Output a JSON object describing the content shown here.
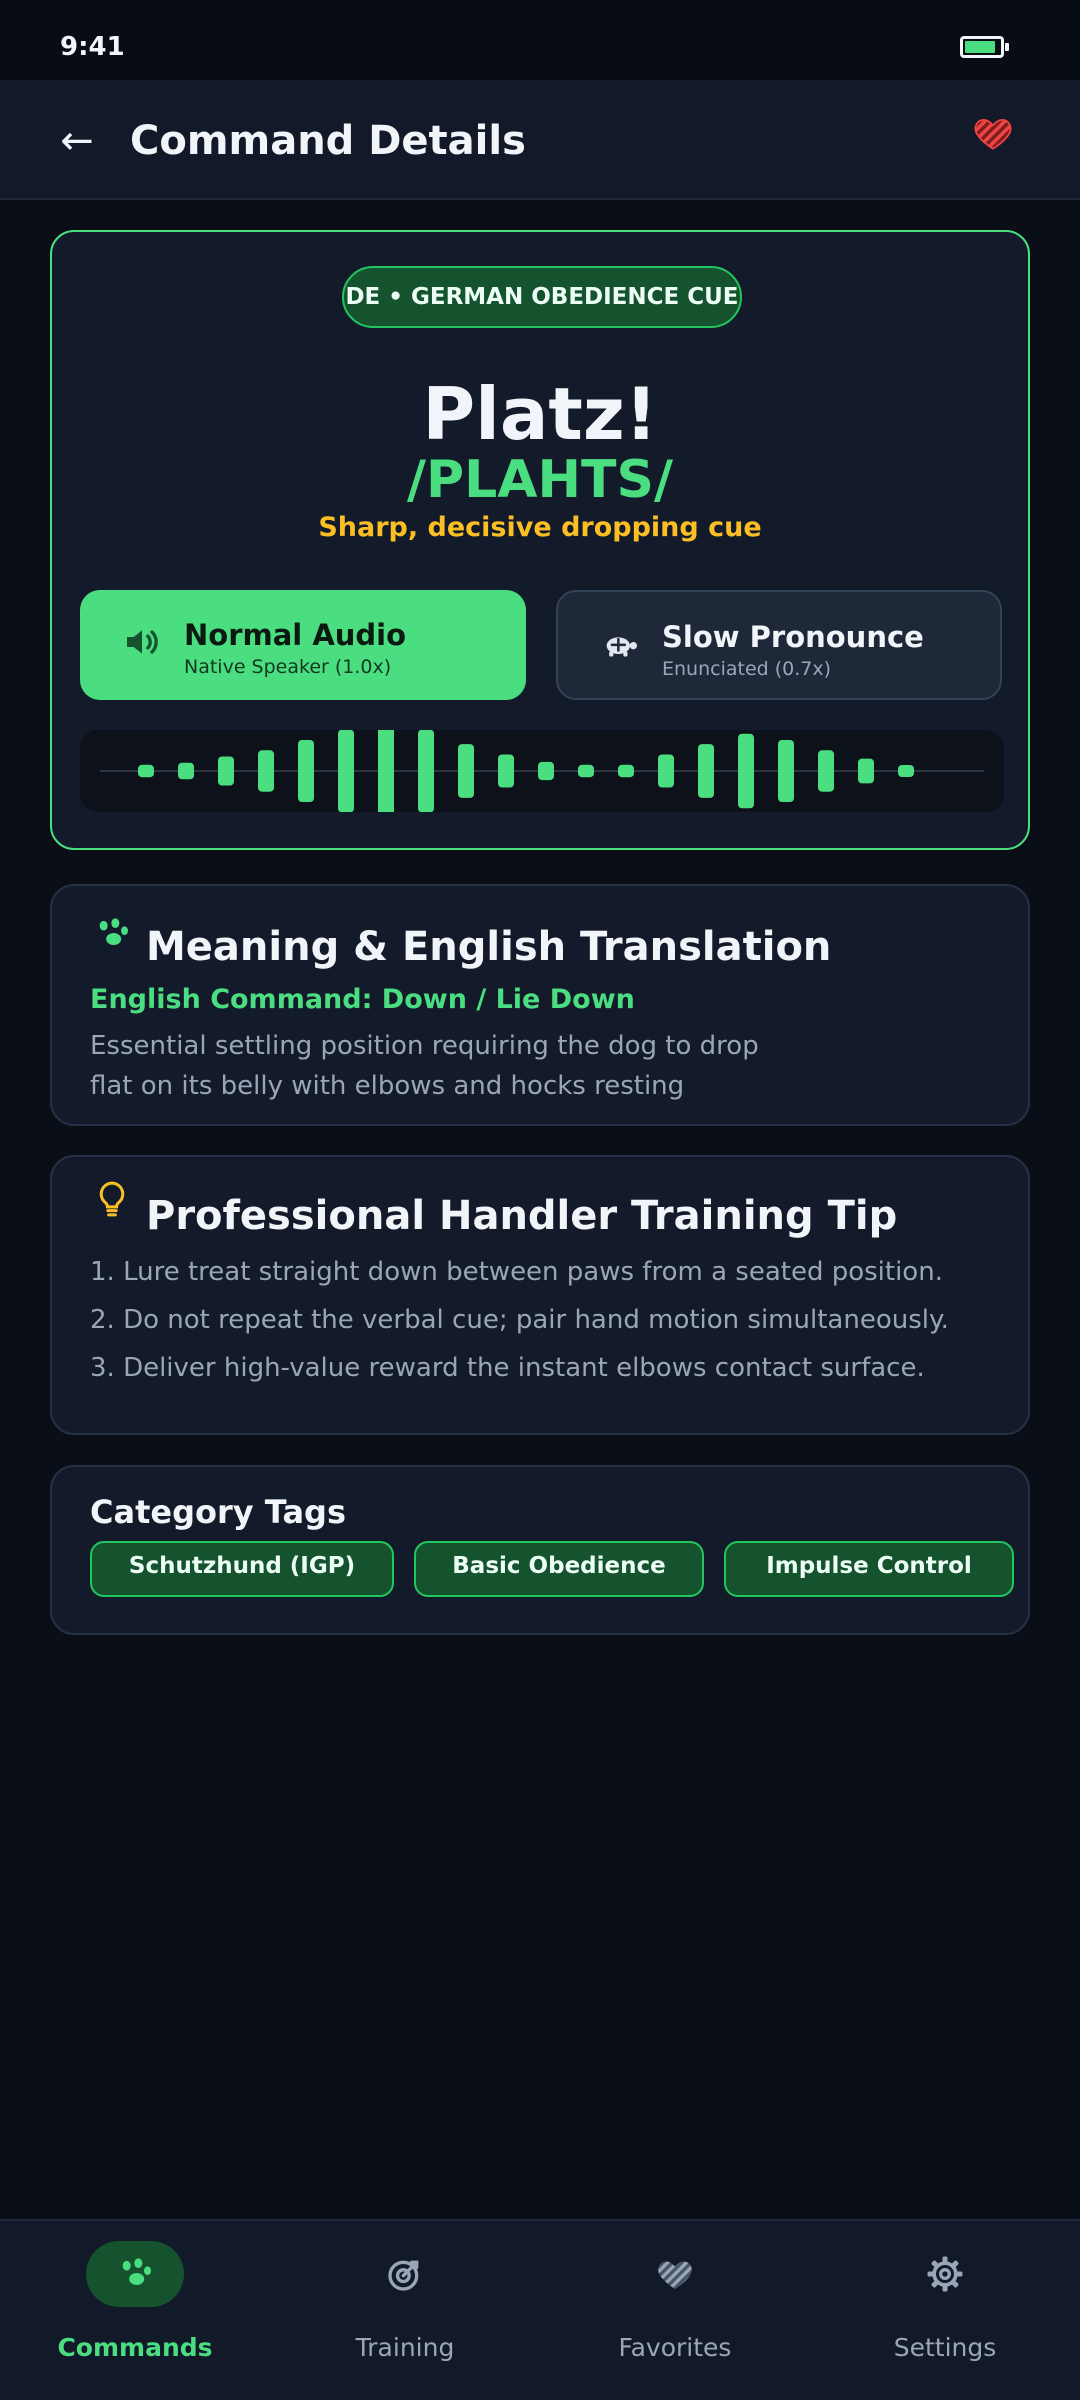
{
  "status_bar": {
    "time": "9:41",
    "battery_icon": "battery-icon"
  },
  "header": {
    "back_icon": "←",
    "title": "Command Details",
    "favorite_icon": "heart-icon"
  },
  "command": {
    "badge": "DE • GERMAN OBEDIENCE CUE",
    "word": "Platz!",
    "phonetic": "/PLAHTS/",
    "note": "Sharp, decisive dropping cue"
  },
  "audio": {
    "normal": {
      "title": "Normal Audio",
      "subtitle": "Native Speaker (1.0x)",
      "icon": "speaker-icon"
    },
    "slow": {
      "title": "Slow Pronounce",
      "subtitle": "Enunciated (0.7x)",
      "icon": "turtle-icon"
    },
    "waveform_levels": [
      0.15,
      0.2,
      0.35,
      0.5,
      0.75,
      1.0,
      1.2,
      1.0,
      0.65,
      0.4,
      0.22,
      0.15,
      0.15,
      0.4,
      0.65,
      0.9,
      0.75,
      0.5,
      0.3,
      0.12
    ]
  },
  "meaning": {
    "icon": "paw-icon",
    "title": "Meaning & English Translation",
    "english": "English Command: Down / Lie Down",
    "body": "Essential settling position requiring the dog to drop flat on its belly with elbows and hocks resting"
  },
  "tip": {
    "icon": "lightbulb-icon",
    "title": "Professional Handler Training Tip",
    "lines": [
      "1. Lure treat straight down between paws from a seated position.",
      "2. Do not repeat the verbal cue; pair hand motion simultaneously.",
      "3. Deliver high-value reward the instant elbows contact surface."
    ]
  },
  "tags": {
    "title": "Category Tags",
    "items": [
      "Schutzhund (IGP)",
      "Basic Obedience",
      "Impulse Control"
    ]
  },
  "nav": {
    "active": "Commands",
    "items": [
      {
        "label": "Commands",
        "icon": "paw-icon"
      },
      {
        "label": "Training",
        "icon": "target-icon"
      },
      {
        "label": "Favorites",
        "icon": "heart-icon"
      },
      {
        "label": "Settings",
        "icon": "gear-icon"
      }
    ]
  },
  "colors": {
    "accent": "#4ade80",
    "accent_dark": "#14532d",
    "warning": "#fbbf24",
    "favorite": "#ef4444",
    "background": "#0a0e16",
    "card": "#131b2b"
  }
}
